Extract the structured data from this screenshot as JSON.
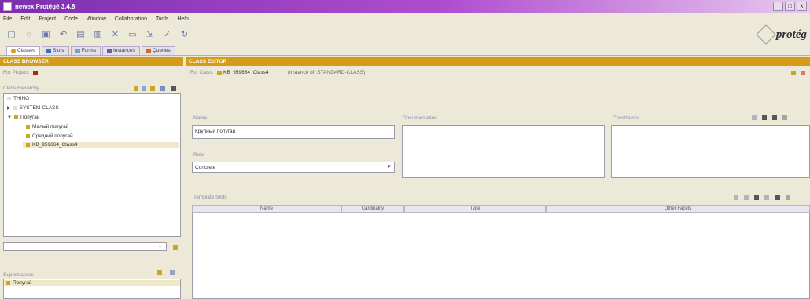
{
  "window": {
    "title": "newex Protégé 3.4.8"
  },
  "menu": [
    "File",
    "Edit",
    "Project",
    "Code",
    "Window",
    "Collaboration",
    "Tools",
    "Help"
  ],
  "toolbar_icons": [
    "new-icon",
    "open-icon",
    "save-icon",
    "undo-icon",
    "copy-icon",
    "paste-icon",
    "delete-icon",
    "print-icon",
    "export-icon",
    "check-icon",
    "revert-icon"
  ],
  "logo": {
    "text": "protég"
  },
  "tabs": [
    {
      "label": "Classes"
    },
    {
      "label": "Slots"
    },
    {
      "label": "Forms"
    },
    {
      "label": "Instances"
    },
    {
      "label": "Queries"
    }
  ],
  "left_panel": {
    "header": "CLASS BROWSER",
    "for_project_label": "For Project:",
    "hierarchy_label": "Class Hierarchy",
    "tree": [
      {
        "label": "THING"
      },
      {
        "label": "SYSTEM-CLASS"
      },
      {
        "label": "Попугай"
      },
      {
        "label": "Малый попугай"
      },
      {
        "label": "Средний попугай"
      },
      {
        "label": "KB_959664_Class4"
      }
    ],
    "superclasses_label": "Superclasses",
    "superclass_item": "Попугай"
  },
  "right_panel": {
    "header": "CLASS EDITOR",
    "for_class_label": "For Class:",
    "for_class_value": "KB_959664_Class4",
    "instance_of": "(instance of :STANDARD-CLASS)",
    "name_label": "Name",
    "name_value": "Крупный попугай",
    "documentation_label": "Documentation",
    "constraints_label": "Constraints",
    "role_label": "Role",
    "role_value": "Concrete",
    "template_slots_label": "Template Slots",
    "columns": [
      "Name",
      "Cardinality",
      "Type",
      "Other Facets"
    ]
  }
}
